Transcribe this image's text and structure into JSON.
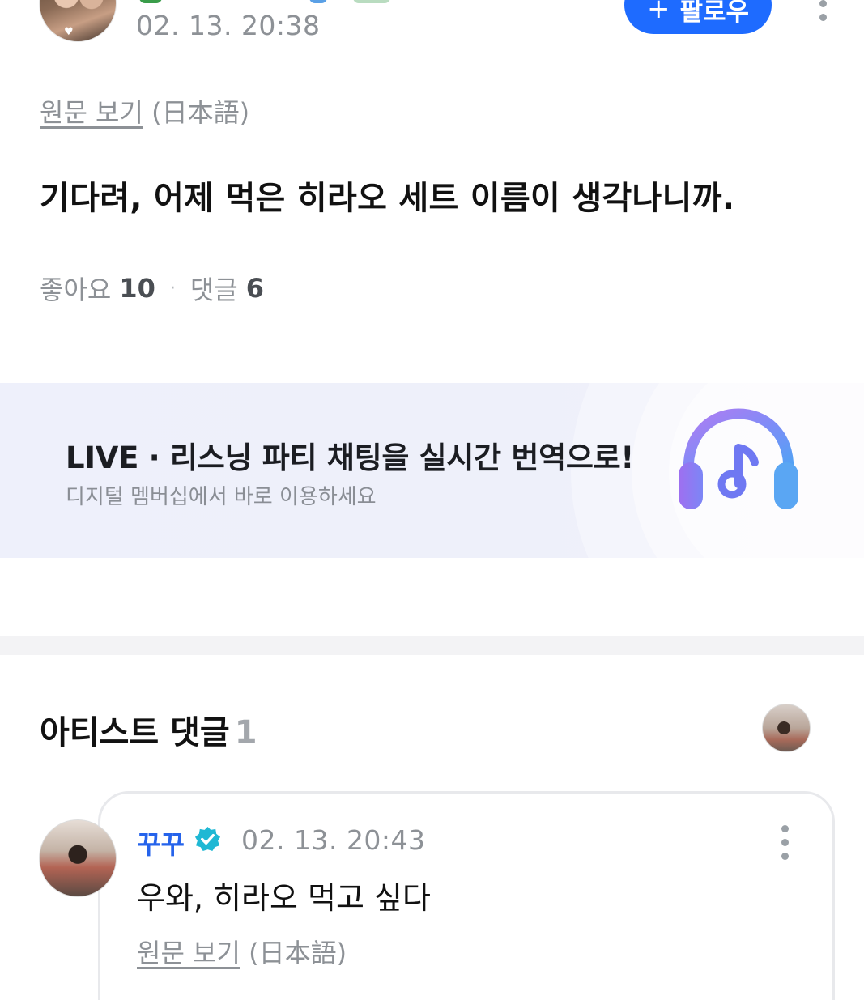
{
  "post": {
    "time": "02. 13. 20:38",
    "follow_label": "팔로우",
    "follow_plus": "+",
    "original_link": "원문 보기",
    "original_lang": "(日本語)",
    "body": "기다려, 어제 먹은 히라오 세트 이름이 생각나니까.",
    "likes_label": "좋아요",
    "likes_count": "10",
    "comments_label": "댓글",
    "comments_count": "6",
    "separator": "·"
  },
  "banner": {
    "title": "LIVE · 리스닝 파티 채팅을 실시간 번역으로!",
    "subtitle": "디지털 멤버십에서 바로 이용하세요",
    "icon": "headphones-music-icon"
  },
  "artist_comments": {
    "title": "아티스트 댓글",
    "count": "1",
    "comment": {
      "name": "꾸꾸",
      "time": "02. 13. 20:43",
      "body": "우와, 히라오 먹고 싶다",
      "original_link": "원문 보기",
      "original_lang": "(日本語)"
    }
  },
  "colors": {
    "accent": "#1e6bff",
    "artist_name": "#2563eb",
    "verified": "#1fb8d4",
    "muted": "#8d9196"
  }
}
